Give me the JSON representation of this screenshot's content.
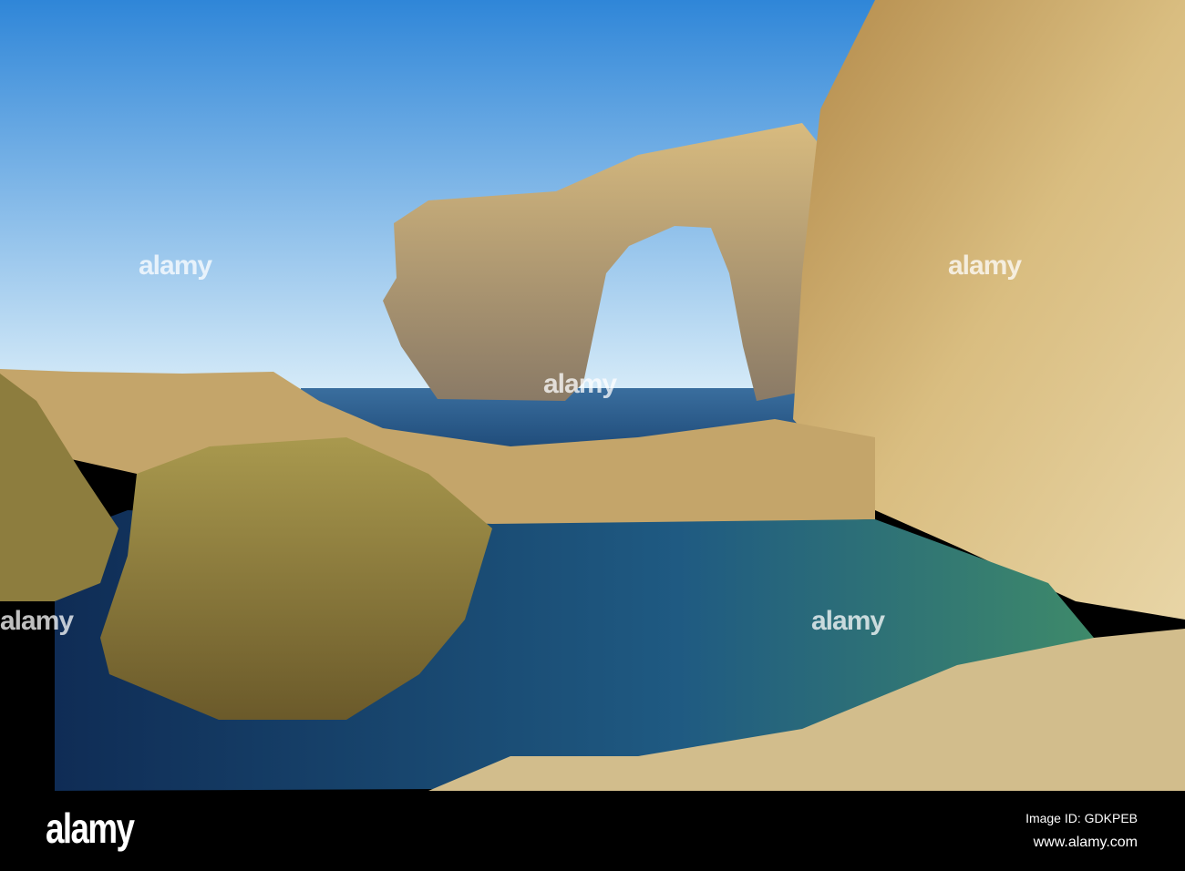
{
  "footer": {
    "logo": "alamy",
    "image_id": "Image ID: GDKPEB",
    "website": "www.alamy.com"
  },
  "watermark": "alamy",
  "colors": {
    "sky_top": "#2f86d8",
    "sky_bottom": "#cfe6f6",
    "sea": "#2a5f93",
    "rock": "#d7b878",
    "pool": "#1f4f7a"
  }
}
